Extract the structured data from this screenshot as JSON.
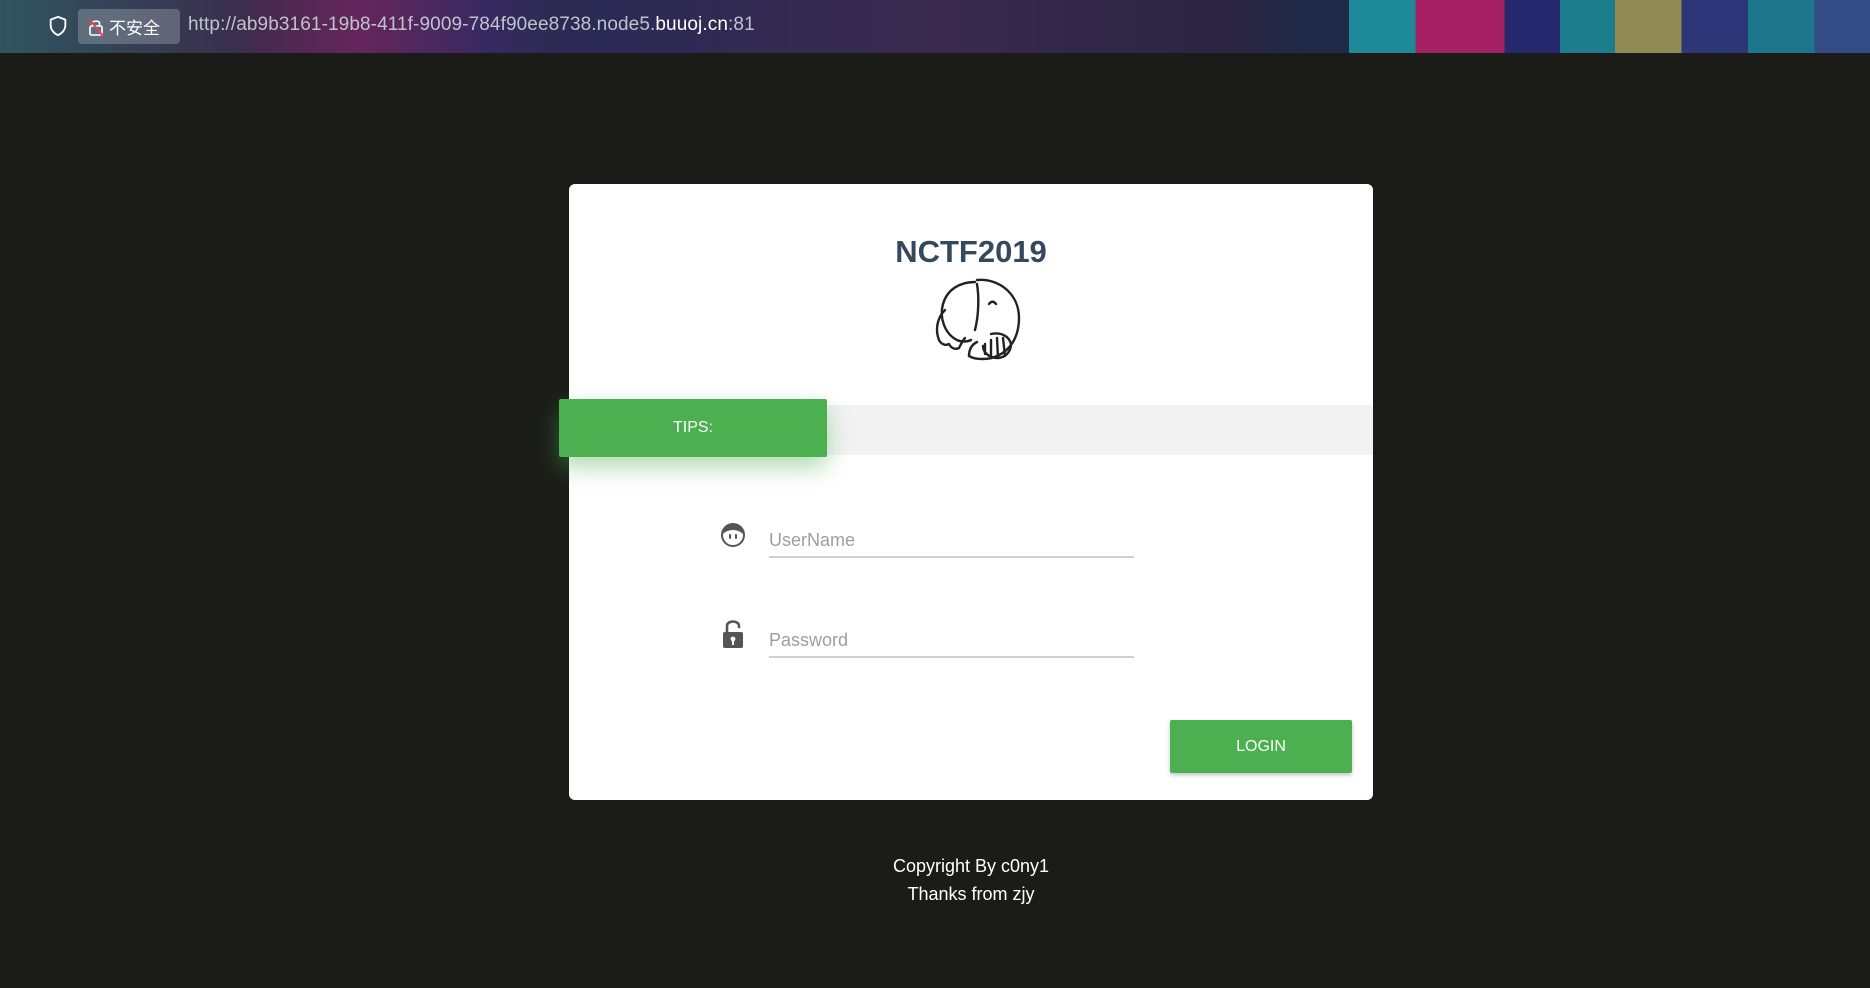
{
  "browser": {
    "insecure_label": "不安全",
    "url_prefix": "http://ab9b3161-19b8-411f-9009-784f90ee8738.node5.",
    "url_domain": "buuoj.cn",
    "url_suffix": ":81"
  },
  "card": {
    "title": "NCTF2019",
    "tips_label": "TIPS:",
    "username_placeholder": "UserName",
    "password_placeholder": "Password",
    "login_label": "LOGIN"
  },
  "footer": {
    "line1": "Copyright By c0ny1",
    "line2": "Thanks from zjy"
  },
  "colors": {
    "background": "#1b1c18",
    "accent_green": "#4caf50",
    "title": "#34495e"
  },
  "icons": {
    "shield": "shield-icon",
    "insecure": "insecure-lock-icon",
    "logo": "elephant-logo-icon",
    "user": "user-face-icon",
    "password": "unlock-icon"
  }
}
